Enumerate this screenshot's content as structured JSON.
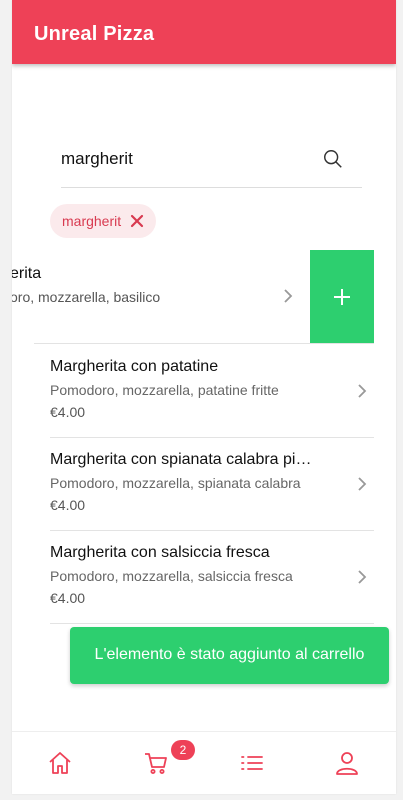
{
  "header": {
    "title": "Unreal Pizza"
  },
  "search": {
    "value": "margherit"
  },
  "filter_chip": {
    "label": "margherit"
  },
  "swiped_item": {
    "name": "erita",
    "description": "oro, mozzarella, basilico"
  },
  "items": [
    {
      "name": "Margherita con patatine",
      "description": "Pomodoro, mozzarella, patatine fritte",
      "price": "€4.00"
    },
    {
      "name": "Margherita con spianata calabra pi…",
      "description": "Pomodoro, mozzarella, spianata calabra",
      "price": "€4.00"
    },
    {
      "name": "Margherita con salsiccia fresca",
      "description": "Pomodoro, mozzarella, salsiccia fresca",
      "price": "€4.00"
    }
  ],
  "toast": {
    "message": "L'elemento è stato aggiunto al carrello"
  },
  "tabbar": {
    "cart_badge": "2"
  },
  "colors": {
    "accent": "#ee4157",
    "success": "#2dcf6f"
  },
  "icons": {
    "search": "search-icon",
    "close": "close-icon",
    "chevron": "chevron-right-icon",
    "add": "plus-icon",
    "home": "home-icon",
    "cart": "cart-icon",
    "list": "list-icon",
    "profile": "user-icon"
  }
}
